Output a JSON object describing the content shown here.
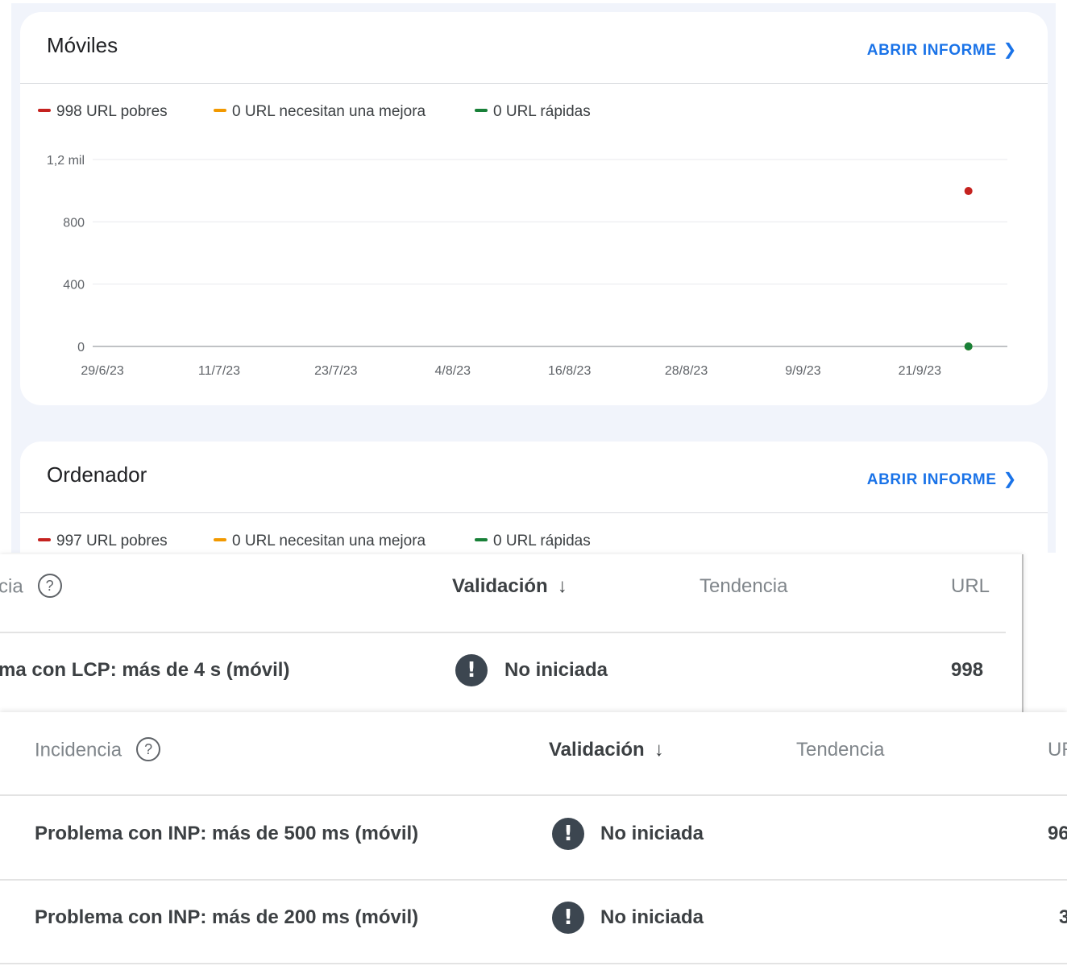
{
  "mobile_card": {
    "title": "Móviles",
    "open_report_label": "ABRIR INFORME",
    "legend": [
      {
        "label": "998 URL pobres",
        "color": "#c5221f"
      },
      {
        "label": "0 URL necesitan una mejora",
        "color": "#f29900"
      },
      {
        "label": "0 URL rápidas",
        "color": "#188038"
      }
    ]
  },
  "desktop_card": {
    "title": "Ordenador",
    "open_report_label": "ABRIR INFORME",
    "legend": [
      {
        "label": "997 URL pobres",
        "color": "#c5221f"
      },
      {
        "label": "0 URL necesitan una mejora",
        "color": "#f29900"
      },
      {
        "label": "0 URL rápidas",
        "color": "#188038"
      }
    ]
  },
  "chart_data": {
    "type": "scatter",
    "title": "",
    "xlabel": "",
    "ylabel": "",
    "y_ticks": [
      "0",
      "400",
      "800",
      "1,2 mil"
    ],
    "y_tick_values": [
      0,
      400,
      800,
      1200
    ],
    "ylim": [
      0,
      1200
    ],
    "x_ticks": [
      "29/6/23",
      "11/7/23",
      "23/7/23",
      "4/8/23",
      "16/8/23",
      "28/8/23",
      "9/9/23",
      "21/9/23"
    ],
    "xlim": [
      "2023-06-28",
      "2023-09-30"
    ],
    "grid": true,
    "legend": "top-left",
    "series": [
      {
        "name": "998 URL pobres",
        "color": "#c5221f",
        "points": [
          {
            "x": "2023-09-26",
            "y": 998
          }
        ]
      },
      {
        "name": "0 URL necesitan una mejora",
        "color": "#f29900",
        "points": [
          {
            "x": "2023-09-26",
            "y": 0
          }
        ]
      },
      {
        "name": "0 URL rápidas",
        "color": "#188038",
        "points": [
          {
            "x": "2023-09-26",
            "y": 0
          }
        ]
      }
    ]
  },
  "table_lcp": {
    "headers": {
      "issue_partial": "cia",
      "validation": "Validación",
      "arrow": "↓",
      "trend": "Tendencia",
      "url": "URL"
    },
    "rows": [
      {
        "issue": "ma con LCP: más de 4 s (móvil)",
        "status": "No iniciada",
        "urls": "998"
      }
    ]
  },
  "table_inp": {
    "headers": {
      "issue": "Incidencia",
      "validation": "Validación",
      "arrow": "↓",
      "trend": "Tendencia",
      "url": "UR"
    },
    "rows": [
      {
        "issue": "Problema con INP: más de 500 ms (móvil)",
        "status": "No iniciada",
        "urls": "96"
      },
      {
        "issue": "Problema con INP: más de 200 ms (móvil)",
        "status": "No iniciada",
        "urls": "3"
      }
    ]
  }
}
